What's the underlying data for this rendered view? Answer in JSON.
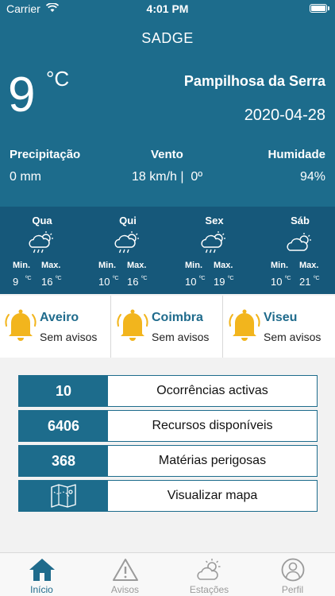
{
  "status_bar": {
    "carrier": "Carrier",
    "time": "4:01 PM"
  },
  "header": {
    "title": "SADGE"
  },
  "current": {
    "temperature": "9",
    "unit": "°C",
    "city": "Pampilhosa da Serra",
    "date": "2020-04-28"
  },
  "stats": {
    "precip_label": "Precipitação",
    "precip_value": "0 mm",
    "wind_label": "Vento",
    "wind_value": "18 km/h |  0º",
    "humidity_label": "Humidade",
    "humidity_value": "94%"
  },
  "forecast": [
    {
      "day": "Qua",
      "icon": "rain-cloud-sun-icon",
      "min_label": "Min.",
      "max_label": "Max.",
      "min": "9",
      "max": "16",
      "unit": "ºC"
    },
    {
      "day": "Qui",
      "icon": "rain-cloud-sun-icon",
      "min_label": "Min.",
      "max_label": "Max.",
      "min": "10",
      "max": "16",
      "unit": "ºC"
    },
    {
      "day": "Sex",
      "icon": "rain-cloud-sun-icon",
      "min_label": "Min.",
      "max_label": "Max.",
      "min": "10",
      "max": "19",
      "unit": "ºC"
    },
    {
      "day": "Sáb",
      "icon": "cloud-sun-icon",
      "min_label": "Min.",
      "max_label": "Max.",
      "min": "10",
      "max": "21",
      "unit": "ºC"
    }
  ],
  "alerts": [
    {
      "name": "Aveiro",
      "status": "Sem avisos"
    },
    {
      "name": "Coimbra",
      "status": "Sem avisos"
    },
    {
      "name": "Viseu",
      "status": "Sem avisos"
    }
  ],
  "summary": {
    "active_value": "10",
    "active_label": "Ocorrências activas",
    "resources_value": "6406",
    "resources_label": "Recursos disponíveis",
    "hazard_value": "368",
    "hazard_label": "Matérias perigosas",
    "map_icon": "map-icon",
    "map_label": "Visualizar mapa"
  },
  "tabs": [
    {
      "label": "Início",
      "icon": "home-icon",
      "active": true
    },
    {
      "label": "Avisos",
      "icon": "warning-icon",
      "active": false
    },
    {
      "label": "Estações",
      "icon": "cloud-sun-icon",
      "active": false
    },
    {
      "label": "Perfil",
      "icon": "user-icon",
      "active": false
    }
  ],
  "colors": {
    "primary": "#1d6c8c",
    "forecast_bg": "#16587a",
    "accent_text": "#1f6b8c",
    "bell": "#f2b51d"
  }
}
